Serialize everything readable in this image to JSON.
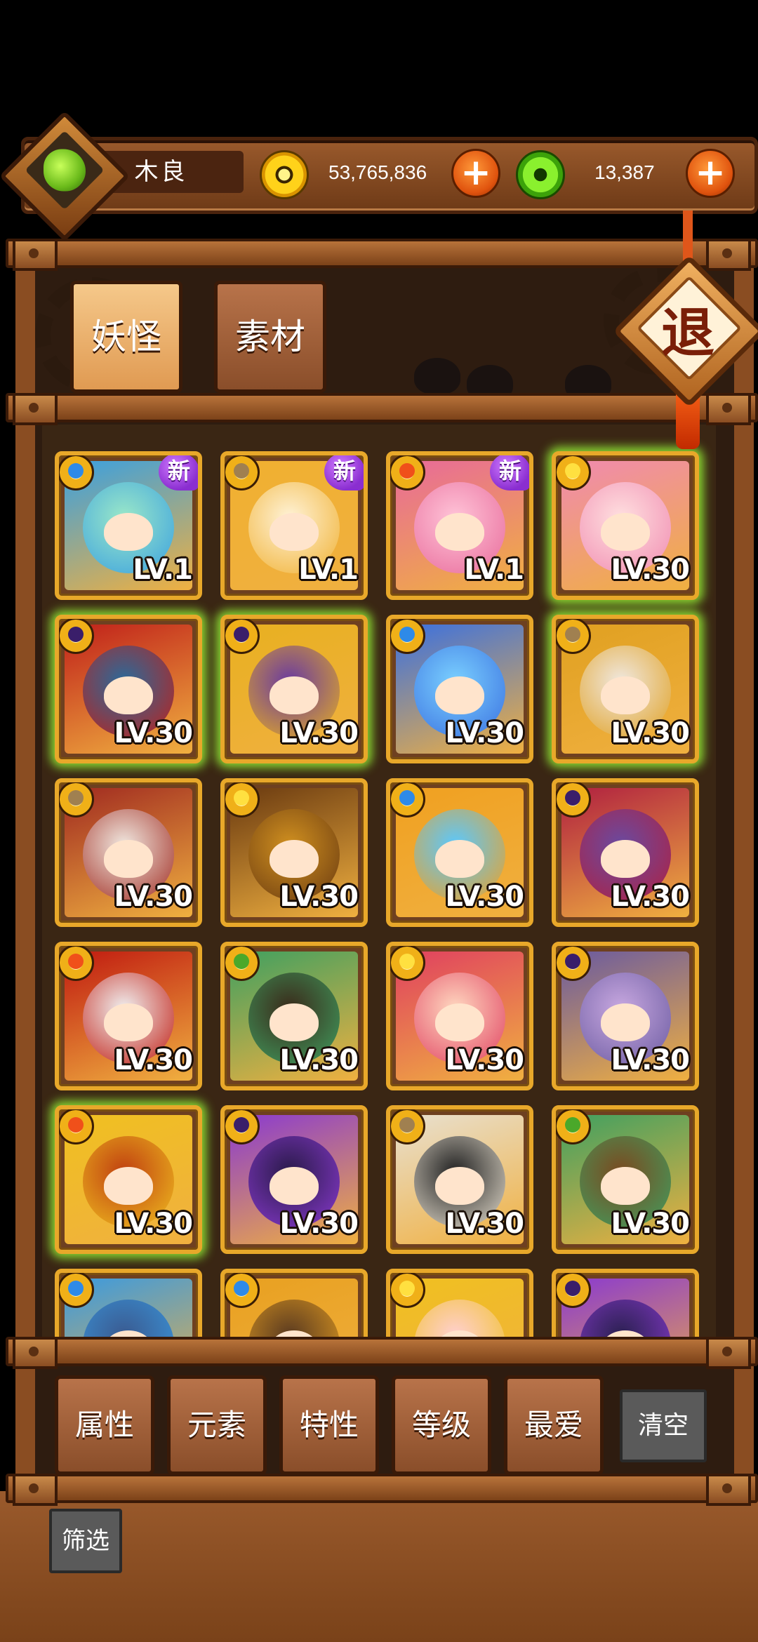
{
  "player": {
    "name": "木良"
  },
  "currency": {
    "gold": "53,765,836",
    "gems": "13,387",
    "plus_label": "+"
  },
  "tabs": [
    {
      "label": "妖怪",
      "active": true
    },
    {
      "label": "素材",
      "active": false
    }
  ],
  "exit_label": "退",
  "new_badge_label": "新",
  "monsters": [
    {
      "level": "LV.1",
      "element": "water",
      "new": true,
      "glow": false,
      "palette": [
        "#9be8c8",
        "#3aa0e0"
      ]
    },
    {
      "level": "LV.1",
      "element": "earth",
      "new": true,
      "glow": false,
      "palette": [
        "#fff3d8",
        "#f0b030"
      ]
    },
    {
      "level": "LV.1",
      "element": "fire",
      "new": true,
      "glow": false,
      "palette": [
        "#ffc4d8",
        "#e86a9a"
      ]
    },
    {
      "level": "LV.30",
      "element": "light",
      "new": false,
      "glow": true,
      "palette": [
        "#ffe0e0",
        "#f08ab0"
      ]
    },
    {
      "level": "LV.30",
      "element": "dark",
      "new": false,
      "glow": true,
      "palette": [
        "#2a6a9a",
        "#c0201a"
      ]
    },
    {
      "level": "LV.30",
      "element": "dark",
      "new": false,
      "glow": true,
      "palette": [
        "#6a3aa0",
        "#e8b020"
      ]
    },
    {
      "level": "LV.30",
      "element": "water",
      "new": false,
      "glow": false,
      "palette": [
        "#7ad0ff",
        "#3a70e0"
      ]
    },
    {
      "level": "LV.30",
      "element": "earth",
      "new": false,
      "glow": true,
      "palette": [
        "#f0e8e0",
        "#e0a020"
      ]
    },
    {
      "level": "LV.30",
      "element": "earth",
      "new": false,
      "glow": false,
      "palette": [
        "#f0e8e0",
        "#a02a20"
      ]
    },
    {
      "level": "LV.30",
      "element": "light",
      "new": false,
      "glow": false,
      "palette": [
        "#d09020",
        "#6a3a10"
      ]
    },
    {
      "level": "LV.30",
      "element": "water",
      "new": false,
      "glow": false,
      "palette": [
        "#5ac8ff",
        "#f0a020"
      ]
    },
    {
      "level": "LV.30",
      "element": "dark",
      "new": false,
      "glow": false,
      "palette": [
        "#6a4aa0",
        "#b02040"
      ]
    },
    {
      "level": "LV.30",
      "element": "fire",
      "new": false,
      "glow": false,
      "palette": [
        "#f0f0f0",
        "#c01a10"
      ]
    },
    {
      "level": "LV.30",
      "element": "wood",
      "new": false,
      "glow": false,
      "palette": [
        "#3a2a1a",
        "#40a060"
      ]
    },
    {
      "level": "LV.30",
      "element": "light",
      "new": false,
      "glow": false,
      "palette": [
        "#ffd8c0",
        "#e04060"
      ]
    },
    {
      "level": "LV.30",
      "element": "dark",
      "new": false,
      "glow": false,
      "palette": [
        "#c8a8e0",
        "#6a5aa0"
      ]
    },
    {
      "level": "LV.30",
      "element": "fire",
      "new": false,
      "glow": true,
      "palette": [
        "#c04010",
        "#f0c020"
      ]
    },
    {
      "level": "LV.30",
      "element": "dark",
      "new": false,
      "glow": false,
      "palette": [
        "#2a1a4a",
        "#8a3ad0"
      ]
    },
    {
      "level": "LV.30",
      "element": "earth",
      "new": false,
      "glow": false,
      "palette": [
        "#222222",
        "#e8e0d0"
      ]
    },
    {
      "level": "LV.30",
      "element": "wood",
      "new": false,
      "glow": false,
      "palette": [
        "#7a4a20",
        "#40a060"
      ]
    },
    {
      "level": "",
      "element": "water",
      "new": false,
      "glow": false,
      "palette": [
        "#3a5a90",
        "#3a9ae0"
      ]
    },
    {
      "level": "",
      "element": "water",
      "new": false,
      "glow": false,
      "palette": [
        "#5a3a20",
        "#e8a020"
      ]
    },
    {
      "level": "",
      "element": "light",
      "new": false,
      "glow": false,
      "palette": [
        "#ffd0d0",
        "#f0c020"
      ]
    },
    {
      "level": "",
      "element": "dark",
      "new": false,
      "glow": false,
      "palette": [
        "#2a2050",
        "#8a3ad0"
      ]
    }
  ],
  "element_colors": {
    "water": "#2e8ae8",
    "earth": "#a08050",
    "fire": "#f0501a",
    "light": "#ffe040",
    "dark": "#3a1e6a",
    "wood": "#4aa82a"
  },
  "filters": [
    {
      "label": "属性"
    },
    {
      "label": "元素"
    },
    {
      "label": "特性"
    },
    {
      "label": "等级"
    },
    {
      "label": "最爱"
    }
  ],
  "clear_label": "清空",
  "screen_label": "筛选"
}
